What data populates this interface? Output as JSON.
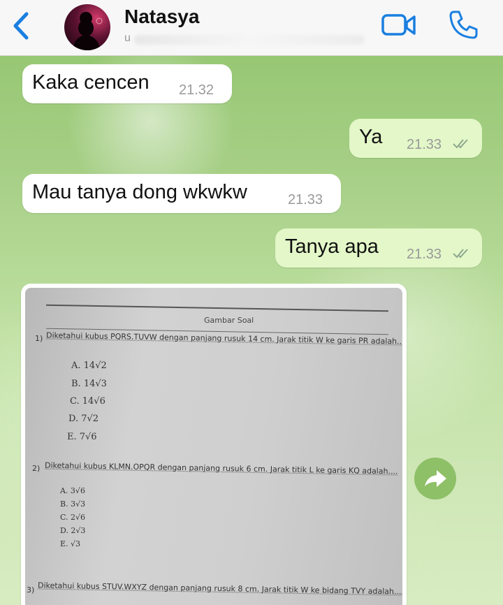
{
  "header": {
    "contact_name": "Natasya",
    "contact_status": "u",
    "icons": {
      "back": "chevron-left-icon",
      "video": "video-call-icon",
      "call": "phone-icon"
    },
    "accent_color": "#1a7fe0"
  },
  "messages": [
    {
      "direction": "incoming",
      "text": "Kaka cencen",
      "time": "21.32"
    },
    {
      "direction": "outgoing",
      "text": "Ya",
      "time": "21.33",
      "status": "read-double-tick"
    },
    {
      "direction": "incoming",
      "text": "Mau tanya dong wkwkw",
      "time": "21.33"
    },
    {
      "direction": "outgoing",
      "text": "Tanya apa",
      "time": "21.33",
      "status": "read-double-tick"
    }
  ],
  "image_message": {
    "title": "Gambar Soal",
    "questions": [
      {
        "number": "1)",
        "text": "Diketahui kubus PQRS.TUVW dengan panjang rusuk 14 cm. Jarak titik W ke garis PR adalah....",
        "options": [
          "A. 14√2",
          "B. 14√3",
          "C. 14√6",
          "D. 7√2",
          "E. 7√6"
        ]
      },
      {
        "number": "2)",
        "text": "Diketahui kubus KLMN.OPQR dengan panjang rusuk 6 cm. Jarak titik L ke garis KQ adalah....",
        "options": [
          "A. 3√6",
          "B. 3√3",
          "C. 2√6",
          "D. 2√3",
          "E. √3"
        ]
      },
      {
        "number": "3)",
        "text": "Diketahui kubus STUV.WXYZ dengan panjang rusuk 8 cm. Jarak titik W ke bidang TVY adalah...."
      }
    ]
  },
  "forward_icon": "forward-arrow-icon"
}
